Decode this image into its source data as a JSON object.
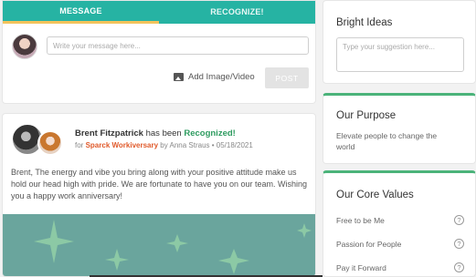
{
  "composer": {
    "tabs": [
      {
        "label": "MESSAGE",
        "active": true
      },
      {
        "label": "RECOGNIZE!",
        "active": false
      }
    ],
    "message_placeholder": "Write your message here...",
    "add_media_label": "Add Image/Video",
    "post_label": "POST"
  },
  "feed": {
    "post": {
      "recipient": "Brent Fitzpatrick",
      "has_been": "has been",
      "recognized_word": "Recognized!",
      "for_word": "for",
      "badge": "Sparck Workiversary",
      "by_text": "by Anna Straus • 05/18/2021",
      "body": "Brent, The energy and vibe you bring along with your positive attitude make us hold our head high with pride. We are fortunate to have you on our team. Wishing you a happy work anniversary!"
    }
  },
  "sidebar": {
    "ideas": {
      "title": "Bright Ideas",
      "placeholder": "Type your suggestion here..."
    },
    "purpose": {
      "title": "Our Purpose",
      "text": "Elevate people to change the world"
    },
    "values": {
      "title": "Our Core Values",
      "items": [
        {
          "label": "Free to be Me"
        },
        {
          "label": "Passion for People"
        },
        {
          "label": "Pay it Forward"
        }
      ],
      "help_glyph": "?"
    }
  },
  "colors": {
    "teal": "#26b3a3",
    "tab_underline": "#f3c35b",
    "recognized": "#2d9b5f",
    "badge": "#e05a2b",
    "banner": "#6aa59d"
  }
}
